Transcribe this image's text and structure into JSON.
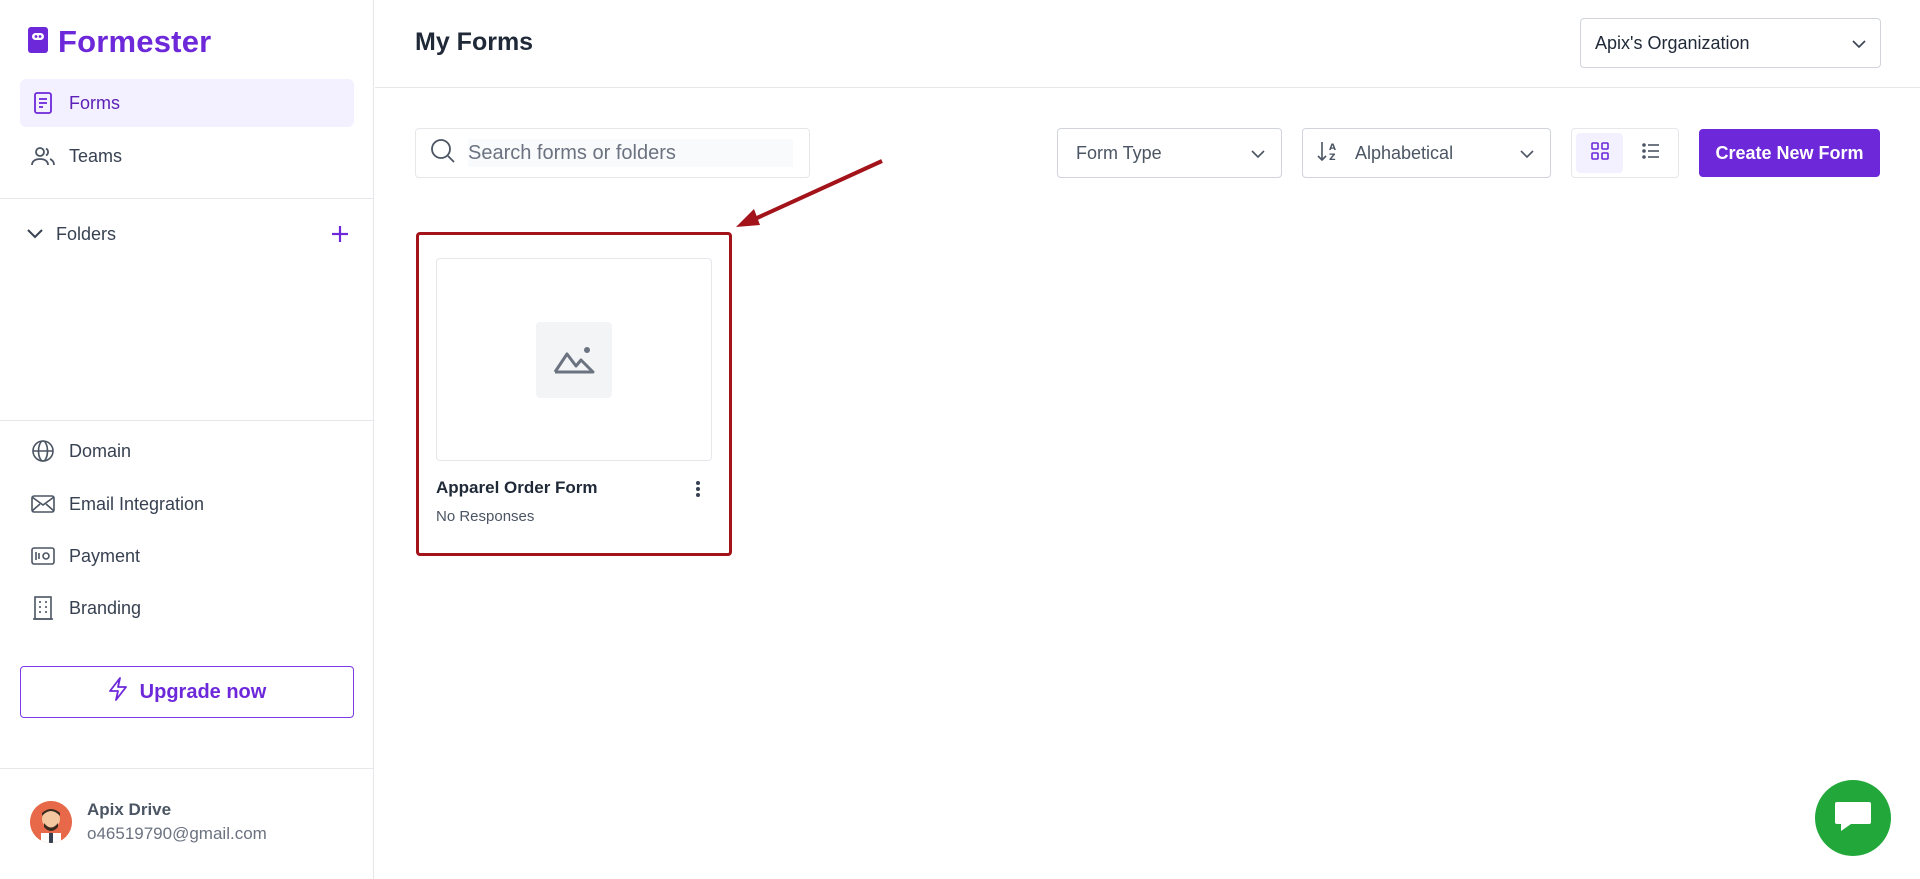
{
  "app": {
    "name": "Formester"
  },
  "sidebar": {
    "nav": [
      {
        "label": "Forms"
      },
      {
        "label": "Teams"
      }
    ],
    "folders_label": "Folders",
    "settings": [
      {
        "label": "Domain"
      },
      {
        "label": "Email Integration"
      },
      {
        "label": "Payment"
      },
      {
        "label": "Branding"
      }
    ],
    "upgrade_label": "Upgrade now",
    "user": {
      "name": "Apix Drive",
      "email": "o46519790@gmail.com"
    }
  },
  "header": {
    "title": "My Forms",
    "organization": "Apix's Organization"
  },
  "toolbar": {
    "search_placeholder": "Search forms or folders",
    "form_type_label": "Form Type",
    "sort_label": "Alphabetical",
    "create_label": "Create New Form"
  },
  "forms": [
    {
      "title": "Apparel Order Form",
      "responses": "No Responses"
    }
  ],
  "colors": {
    "accent": "#6d28d9",
    "highlight": "#a3131a",
    "chat": "#22a83a"
  }
}
